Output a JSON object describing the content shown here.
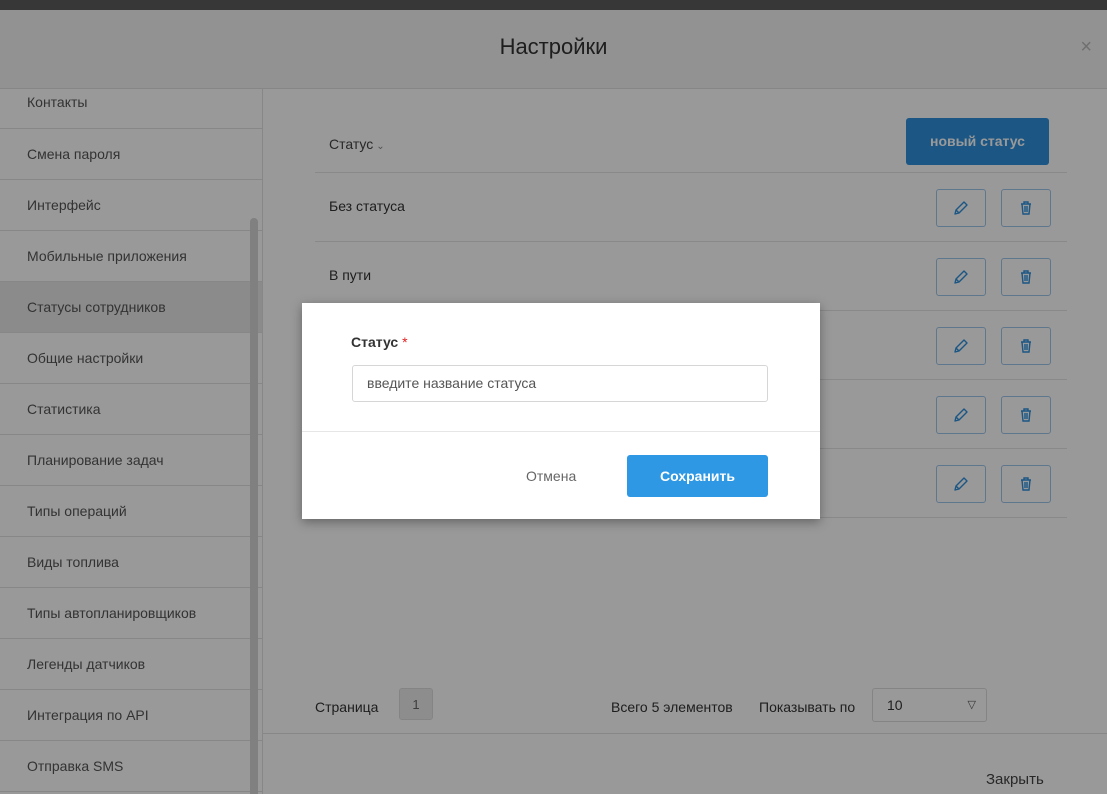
{
  "window": {
    "title": "Настройки",
    "close_glyph": "×"
  },
  "sidebar": {
    "items": [
      {
        "label": "Контакты"
      },
      {
        "label": "Смена пароля"
      },
      {
        "label": "Интерфейс"
      },
      {
        "label": "Мобильные приложения"
      },
      {
        "label": "Статусы сотрудников",
        "active": true
      },
      {
        "label": "Общие настройки"
      },
      {
        "label": "Статистика"
      },
      {
        "label": "Планирование задач"
      },
      {
        "label": "Типы операций"
      },
      {
        "label": "Виды топлива"
      },
      {
        "label": "Типы автопланировщиков"
      },
      {
        "label": "Легенды датчиков"
      },
      {
        "label": "Интеграция по API"
      },
      {
        "label": "Отправка SMS"
      }
    ]
  },
  "table": {
    "column_header": "Статус",
    "sort_icon": "chevron-down-icon",
    "new_button_label": "новый статус",
    "rows": [
      {
        "name": "Без статуса"
      },
      {
        "name": "В пути"
      },
      {
        "name": ""
      },
      {
        "name": ""
      },
      {
        "name": ""
      }
    ],
    "row_actions": [
      "pencil-icon",
      "trash-icon"
    ]
  },
  "pager": {
    "page_label": "Страница",
    "current_page": "1",
    "total_text": "Всего 5 элементов",
    "show_label": "Показывать по",
    "page_size": "10"
  },
  "footer": {
    "close_label": "Закрыть"
  },
  "modal": {
    "field_label": "Статус",
    "required_mark": "*",
    "input_placeholder": "введите название статуса",
    "input_value": "",
    "cancel_label": "Отмена",
    "save_label": "Сохранить"
  },
  "colors": {
    "accent": "#2e8fdc",
    "overlay": "rgba(0,0,0,0.40)",
    "required": "#e02020"
  }
}
